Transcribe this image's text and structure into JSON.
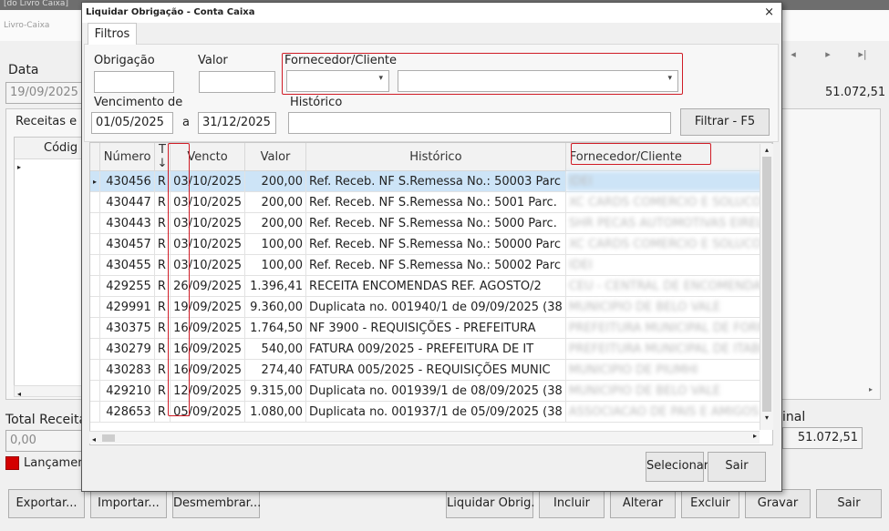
{
  "background": {
    "window_title": "[do Livro Caixa]",
    "subtitle": "Livro-Caixa",
    "date_label": "Data",
    "date_value": "19/09/2025",
    "receitas_tab": "Receitas e D",
    "codigo_header": "Códig",
    "balance_right": "51.072,51",
    "total_receita_label": "Total Receita",
    "total_receita_value": "0,00",
    "final_label": "inal",
    "final_value": "51.072,51",
    "lancamento_label": "Lançamen",
    "legend_color": "#d40000",
    "nav_icons": [
      "prev-icon",
      "next-icon",
      "last-icon"
    ]
  },
  "modal": {
    "title": "Liquidar Obrigação - Conta Caixa",
    "close_label": "×",
    "tab_label": "Filtros",
    "filters": {
      "obrigacao_label": "Obrigação",
      "valor_label": "Valor",
      "fornecedor_label": "Fornecedor/Cliente",
      "vencimento_label": "Vencimento de",
      "venc_de": "01/05/2025",
      "a_label": "a",
      "venc_ate": "31/12/2025",
      "historico_label": "Histórico",
      "filtrar_button": "Filtrar - F5"
    },
    "grid": {
      "columns": [
        "Número",
        "T ↓",
        "Vencto",
        "Valor",
        "Histórico",
        "Fornecedor/Cliente"
      ],
      "rows": [
        {
          "numero": "430456",
          "t": "R",
          "vencto": "03/10/2025",
          "valor": "200,00",
          "historico": "Ref. Receb. NF S.Remessa No.: 50003 Parc",
          "fornecedor": "IDEI"
        },
        {
          "numero": "430447",
          "t": "R",
          "vencto": "03/10/2025",
          "valor": "200,00",
          "historico": "Ref. Receb. NF S.Remessa No.: 5001 Parc.",
          "fornecedor": "XC CARDS COMERCIO E SOLUCO"
        },
        {
          "numero": "430443",
          "t": "R",
          "vencto": "03/10/2025",
          "valor": "200,00",
          "historico": "Ref. Receb. NF S.Remessa No.: 5000 Parc.",
          "fornecedor": "SHR PECAS AUTOMOTIVAS EIRELI"
        },
        {
          "numero": "430457",
          "t": "R",
          "vencto": "03/10/2025",
          "valor": "100,00",
          "historico": "Ref. Receb. NF S.Remessa No.: 50000 Parc",
          "fornecedor": "XC CARDS COMERCIO E SOLUCO"
        },
        {
          "numero": "430455",
          "t": "R",
          "vencto": "03/10/2025",
          "valor": "100,00",
          "historico": "Ref. Receb. NF S.Remessa No.: 50002 Parc",
          "fornecedor": "IDEI"
        },
        {
          "numero": "429255",
          "t": "R",
          "vencto": "26/09/2025",
          "valor": "1.396,41",
          "historico": "RECEITA ENCOMENDAS REF. AGOSTO/2",
          "fornecedor": "CEU - CENTRAL DE ENCOMENDAS"
        },
        {
          "numero": "429991",
          "t": "R",
          "vencto": "19/09/2025",
          "valor": "9.360,00",
          "historico": "Duplicata no. 001940/1 de 09/09/2025 (38",
          "fornecedor": "MUNICIPIO DE BELO VALE"
        },
        {
          "numero": "430375",
          "t": "R",
          "vencto": "16/09/2025",
          "valor": "1.764,50",
          "historico": "NF 3900 - REQUISIÇÕES - PREFEITURA",
          "fornecedor": "PREFEITURA MUNICIPAL DE FORM"
        },
        {
          "numero": "430279",
          "t": "R",
          "vencto": "16/09/2025",
          "valor": "540,00",
          "historico": "FATURA 009/2025 - PREFEITURA DE IT",
          "fornecedor": "PREFEITURA MUNICIPAL DE ITABI"
        },
        {
          "numero": "430283",
          "t": "R",
          "vencto": "16/09/2025",
          "valor": "274,40",
          "historico": "FATURA 005/2025 - REQUISIÇÕES MUNIC",
          "fornecedor": "MUNICIPIO DE PIUMHI"
        },
        {
          "numero": "429210",
          "t": "R",
          "vencto": "12/09/2025",
          "valor": "9.315,00",
          "historico": "Duplicata no. 001939/1 de 08/09/2025 (38",
          "fornecedor": "MUNICIPIO DE BELO VALE"
        },
        {
          "numero": "428653",
          "t": "R",
          "vencto": "05/09/2025",
          "valor": "1.080,00",
          "historico": "Duplicata no. 001937/1 de 05/09/2025 (38",
          "fornecedor": "ASSOCIACAO DE PAIS E AMIGOS"
        }
      ]
    },
    "selecionar_label": "Selecionar",
    "sair_label": "Sair"
  },
  "toolbar": {
    "exportar": "Exportar...",
    "importar": "Importar...",
    "desmembrar": "Desmembrar...",
    "liquidar": "Liquidar Obrig.",
    "incluir": "Incluir",
    "alterar": "Alterar",
    "excluir": "Excluir",
    "gravar": "Gravar",
    "sair": "Sair"
  },
  "colors": {
    "highlight_border": "#d01c26",
    "selected_row": "#cde4f7"
  }
}
